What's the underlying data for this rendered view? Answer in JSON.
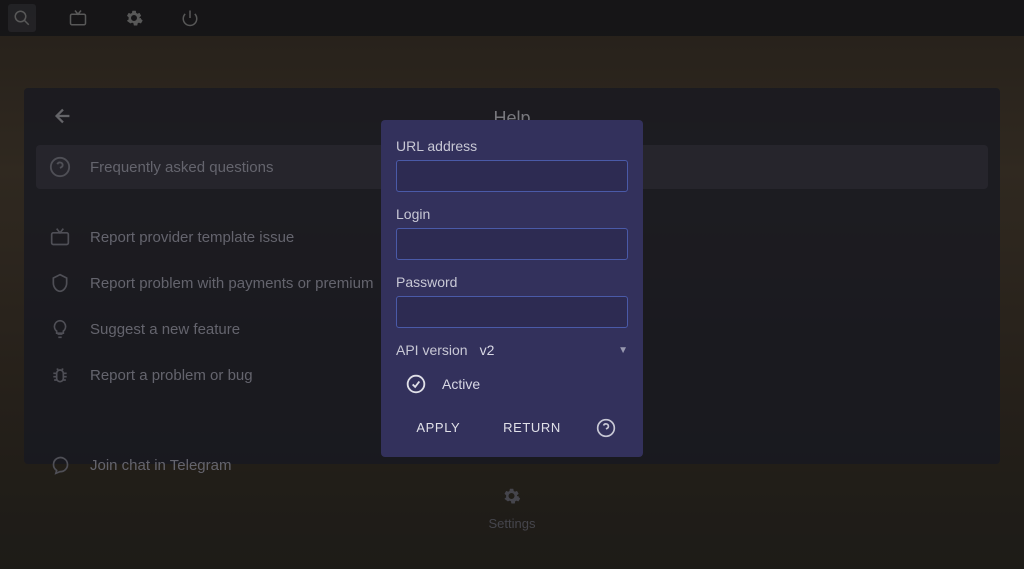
{
  "toolbar": {
    "icons": [
      "search-icon",
      "tv-icon",
      "gear-icon",
      "power-icon"
    ]
  },
  "helpPanel": {
    "title": "Help",
    "items": [
      {
        "icon": "question",
        "label": "Frequently asked questions",
        "highlighted": true
      },
      {
        "icon": "tv",
        "label": "Report provider template issue",
        "highlighted": false
      },
      {
        "icon": "shield",
        "label": "Report problem with payments or premium",
        "highlighted": false
      },
      {
        "icon": "bulb",
        "label": "Suggest a new feature",
        "highlighted": false
      },
      {
        "icon": "bug",
        "label": "Report a problem or bug",
        "highlighted": false
      },
      {
        "icon": "chat",
        "label": "Join chat in Telegram",
        "highlighted": false
      }
    ]
  },
  "bottomLabel": "Settings",
  "modal": {
    "url_label": "URL address",
    "login_label": "Login",
    "password_label": "Password",
    "api_label": "API version",
    "api_value": "v2",
    "active_label": "Active",
    "apply_label": "APPLY",
    "return_label": "RETURN"
  }
}
